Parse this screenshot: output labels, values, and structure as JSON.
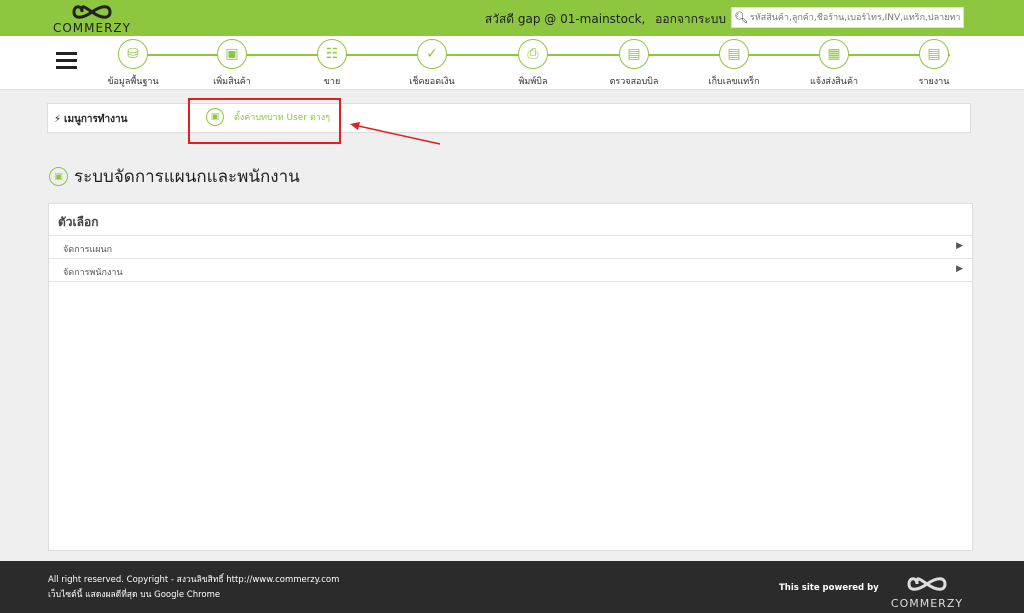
{
  "header": {
    "logo_text": "COMMERZY",
    "greeting": "สวัสดี gap @ 01-mainstock,",
    "logout": "ออกจากระบบ",
    "search_placeholder": "รหัสสินค้า,ลูกค้า,ชื่อร้าน,เบอร์โทร,INV,แทร็ก,ปลายทาง"
  },
  "nav": {
    "items": [
      {
        "label": "ข้อมูลพื้นฐาน",
        "icon": "database-icon"
      },
      {
        "label": "เพิ่มสินค้า",
        "icon": "box-icon"
      },
      {
        "label": "ขาย",
        "icon": "cash-register-icon"
      },
      {
        "label": "เช็คยอดเงิน",
        "icon": "check-money-icon"
      },
      {
        "label": "พิมพ์บิล",
        "icon": "printer-icon"
      },
      {
        "label": "ตรวจสอบบิล",
        "icon": "scanner-icon"
      },
      {
        "label": "เก็บเลขแทร็ก",
        "icon": "barcode-scanner-icon"
      },
      {
        "label": "แจ้งส่งสินค้า",
        "icon": "truck-icon"
      },
      {
        "label": "รายงาน",
        "icon": "report-icon"
      }
    ]
  },
  "workmenu": {
    "title": "เมนูการทำงาน",
    "link_label": "ตั้งค่าบทบาท User ต่างๆ"
  },
  "page": {
    "title": "ระบบจัดการแผนกและพนักงาน"
  },
  "options": {
    "header": "ตัวเลือก",
    "rows": [
      {
        "label": "จัดการแผนก"
      },
      {
        "label": "จัดการพนักงาน"
      }
    ]
  },
  "footer": {
    "copyright": "All right reserved. Copyright - สงวนลิขสิทธิ์ http://www.commerzy.com",
    "browser_note": "เว็บไซต์นี้ แสดงผลดีที่สุด บน Google Chrome",
    "powered_by": "This site powered by",
    "logo_text": "COMMERZY"
  },
  "colors": {
    "brand_green": "#8dc63f",
    "highlight_red": "#e02020",
    "footer_bg": "#2b2b2b"
  }
}
